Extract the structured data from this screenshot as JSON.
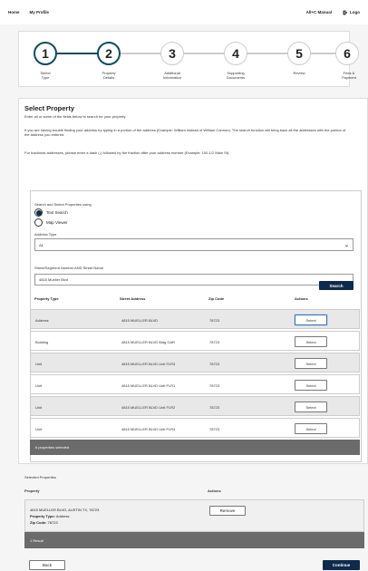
{
  "nav": {
    "home": "Home",
    "profile": "My Profile",
    "manual": "All+C Manual",
    "logout": "Logo"
  },
  "steps": [
    {
      "num": "1",
      "label1": "Select",
      "label2": "Type"
    },
    {
      "num": "2",
      "label1": "Property",
      "label2": "Details"
    },
    {
      "num": "3",
      "label1": "Additional",
      "label2": "Information"
    },
    {
      "num": "4",
      "label1": "Supporting",
      "label2": "Documents"
    },
    {
      "num": "5",
      "label1": "Review",
      "label2": ""
    },
    {
      "num": "6",
      "label1": "Fees &",
      "label2": "Payment"
    }
  ],
  "main": {
    "title": "Select Property",
    "intro": "Enter all or some of the fields below to search for your property.",
    "tip1": "If you are having trouble finding your address try typing in a portion of the address (Example: William instead of William Cannon). The search function will bring back all the addresses with the portion of the address you entered.",
    "tip2": "For fractional addresses, please enter a dash (-) followed by the fraction after your address number (Example: 100-1/2 Main St)."
  },
  "search": {
    "method_label": "Search and Select Properties using",
    "option_text": "Text Search",
    "option_map": "Map Viewer",
    "address_type_label": "Address Type",
    "address_type_value": "All",
    "street_label": "Street/Segment Number AND Street Name",
    "street_value": "4815 Mueller Blvd",
    "search_button": "Search"
  },
  "table": {
    "headers": {
      "type": "Property Type",
      "address": "Street Address",
      "zip": "Zip Code",
      "actions": "Actions"
    },
    "select_label": "Select",
    "rows": [
      {
        "type": "Address",
        "address": "4815 MUELLER BLVD",
        "zip": "78723"
      },
      {
        "type": "Building",
        "address": "4815 MUELLER BLVD Bldg GAR",
        "zip": "78723"
      },
      {
        "type": "Unit",
        "address": "4815 MUELLER BLVD Unit FLR3",
        "zip": "78723"
      },
      {
        "type": "Unit",
        "address": "4815 MUELLER BLVD Unit FLR1",
        "zip": "78723"
      },
      {
        "type": "Unit",
        "address": "4815 MUELLER BLVD Unit FLR2",
        "zip": "78723"
      },
      {
        "type": "Unit",
        "address": "4815 MUELLER BLVD Unit FLR4",
        "zip": "78723"
      }
    ],
    "footer": "6 properties selected"
  },
  "selected": {
    "section_title": "Selected Properties",
    "header_property": "Property",
    "header_actions": "Actions",
    "address_line": "4815 MUELLER BLVD, AUSTIN TX, 78723",
    "type_label": "Property Type:",
    "type_value": "Address",
    "zip_label": "Zip Code:",
    "zip_value": "78723",
    "remove_button": "Remove",
    "footer": "1 Result"
  },
  "footer_buttons": {
    "back": "Back",
    "continue": "Continue"
  }
}
